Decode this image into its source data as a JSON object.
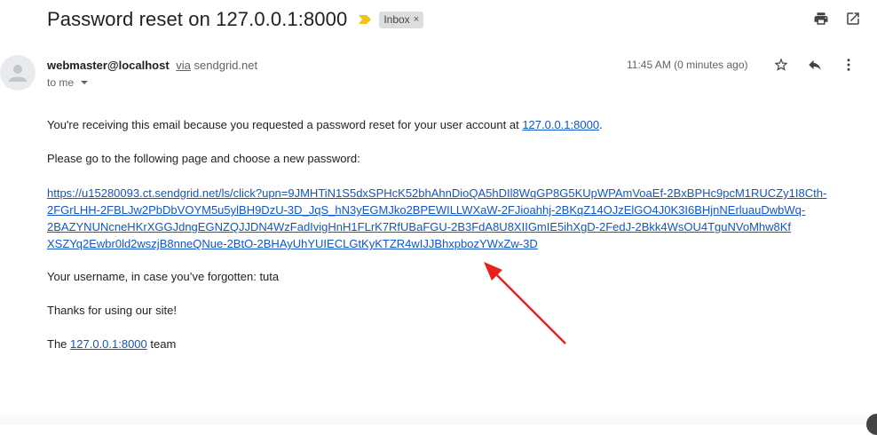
{
  "header": {
    "subject": "Password reset on 127.0.0.1:8000",
    "label": "Inbox",
    "label_close": "×",
    "importance_color": "#f2c21b",
    "icons": [
      "print-icon",
      "open-in-new-window-icon"
    ]
  },
  "message": {
    "sender": "webmaster@localhost",
    "via_word": "via",
    "via_domain": "sendgrid.net",
    "to": "to me",
    "time": "11:45 AM (0 minutes ago)",
    "icons": [
      "star-icon",
      "reply-icon",
      "more-vert-icon"
    ]
  },
  "body": {
    "line1_prefix": "You're receiving this email because you requested a password reset for your user account at ",
    "line1_link": "127.0.0.1:8000",
    "line1_suffix": ".",
    "line2": "Please go to the following page and choose a new password:",
    "reset_link_lines": [
      "https://u15280093.ct.sendgrid.net/ls/click?upn=9JMHTiN1S5dxSPHcK52bhAhnDioQA5hDIl8WqGP8G5KUpWPAmVoaEf-2BxBPHc9pcM1RUCZy1I8Cth-",
      "2FGrLHH-2FBLJw2PbDbVOYM5u5ylBH9DzU-3D_JqS_hN3yEGMJko2BPEWILLWXaW-2FJioahhj-2BKqZ14OJzElGO4J0K3I6BHjnNErluauDwbWq-",
      "2BAZYNUNcneHKrXGGJdngEGNZQJJDN4WzFadIvigHnH1FLrK7RfUBaFGU-2B3FdA8U8XIIGmIE5ihXgD-2FedJ-2Bkk4WsOU4TguNVoMhw8Kf",
      "XSZYq2Ewbr0ld2wszjB8nneQNue-2BtO-2BHAyUhYUIECLGtKyKTZR4wIJJBhxpbozYWxZw-3D"
    ],
    "username_line": "Your username, in case you’ve forgotten: tuta",
    "thanks_line": "Thanks for using our site!",
    "team_prefix": "The ",
    "team_link": "127.0.0.1:8000",
    "team_suffix": " team"
  },
  "annotation": {
    "arrow_color": "#e8221b"
  }
}
